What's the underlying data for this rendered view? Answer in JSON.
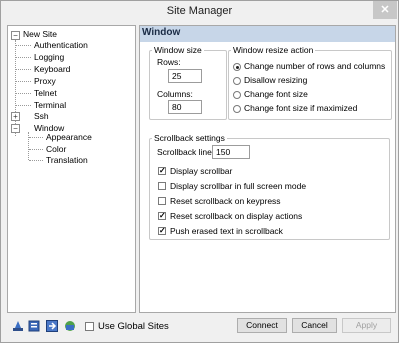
{
  "window": {
    "title": "Site Manager",
    "close_glyph": "✕"
  },
  "tree": {
    "root": "New Site",
    "items": [
      "Authentication",
      "Logging",
      "Keyboard",
      "Proxy",
      "Telnet",
      "Terminal",
      "Ssh",
      "Window"
    ],
    "window_children": [
      "Appearance",
      "Color",
      "Translation"
    ],
    "expand_glyph": "+",
    "collapse_glyph": "−"
  },
  "panel": {
    "title": "Window"
  },
  "window_size": {
    "legend": "Window size",
    "rows_label": "Rows:",
    "rows_value": "25",
    "columns_label": "Columns:",
    "columns_value": "80"
  },
  "resize_action": {
    "legend": "Window resize action",
    "options": [
      "Change number of rows and columns",
      "Disallow resizing",
      "Change font size",
      "Change font size if maximized"
    ],
    "selected_index": 0
  },
  "scrollback": {
    "legend": "Scrollback settings",
    "lines_label": "Scrollback lines:",
    "lines_value": "150",
    "check_glyph": "✓",
    "options": [
      {
        "label": "Display scrollbar",
        "checked": true
      },
      {
        "label": "Display scrollbar in full screen mode",
        "checked": false
      },
      {
        "label": "Reset scrollback on keypress",
        "checked": false
      },
      {
        "label": "Reset scrollback on display actions",
        "checked": true
      },
      {
        "label": "Push erased text in scrollback",
        "checked": true
      }
    ]
  },
  "footer": {
    "use_global_label": "Use Global Sites",
    "use_global_checked": false,
    "connect": "Connect",
    "cancel": "Cancel",
    "apply": "Apply",
    "toolbar_icons": [
      "new-site-icon",
      "new-folder-icon",
      "import-icon",
      "export-icon"
    ]
  }
}
